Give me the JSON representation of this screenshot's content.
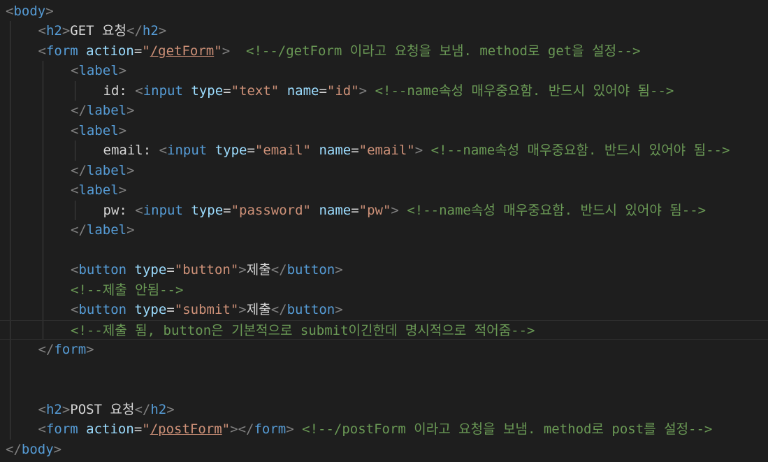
{
  "colors": {
    "background": "#1e1e1e",
    "tag": "#569cd6",
    "bracket": "#808080",
    "attribute": "#9cdcfe",
    "string": "#ce9178",
    "text": "#d4d4d4",
    "comment": "#6a9955"
  },
  "code_lines": [
    {
      "indent": 0,
      "tokens": [
        [
          "bracket",
          "<"
        ],
        [
          "tag",
          "body"
        ],
        [
          "bracket",
          ">"
        ]
      ]
    },
    {
      "indent": 1,
      "tokens": [
        [
          "bracket",
          "<"
        ],
        [
          "tag",
          "h2"
        ],
        [
          "bracket",
          ">"
        ],
        [
          "text",
          "GET 요청"
        ],
        [
          "bracket",
          "</"
        ],
        [
          "tag",
          "h2"
        ],
        [
          "bracket",
          ">"
        ]
      ]
    },
    {
      "indent": 1,
      "tokens": [
        [
          "bracket",
          "<"
        ],
        [
          "tag",
          "form"
        ],
        [
          "text",
          " "
        ],
        [
          "attr",
          "action"
        ],
        [
          "eq",
          "="
        ],
        [
          "str",
          "\""
        ],
        [
          "link",
          "/getForm"
        ],
        [
          "str",
          "\""
        ],
        [
          "bracket",
          ">"
        ],
        [
          "text",
          "  "
        ],
        [
          "comment",
          "<!--/getForm 이라고 요청을 보냄. method로 get을 설정-->"
        ]
      ]
    },
    {
      "indent": 2,
      "tokens": [
        [
          "bracket",
          "<"
        ],
        [
          "tag",
          "label"
        ],
        [
          "bracket",
          ">"
        ]
      ]
    },
    {
      "indent": 3,
      "tokens": [
        [
          "text",
          "id: "
        ],
        [
          "bracket",
          "<"
        ],
        [
          "tag",
          "input"
        ],
        [
          "text",
          " "
        ],
        [
          "attr",
          "type"
        ],
        [
          "eq",
          "="
        ],
        [
          "str",
          "\"text\""
        ],
        [
          "text",
          " "
        ],
        [
          "attr",
          "name"
        ],
        [
          "eq",
          "="
        ],
        [
          "str",
          "\"id\""
        ],
        [
          "bracket",
          ">"
        ],
        [
          "text",
          " "
        ],
        [
          "comment",
          "<!--name속성 매우중요함. 반드시 있어야 됨-->"
        ]
      ]
    },
    {
      "indent": 2,
      "tokens": [
        [
          "bracket",
          "</"
        ],
        [
          "tag",
          "label"
        ],
        [
          "bracket",
          ">"
        ]
      ]
    },
    {
      "indent": 2,
      "tokens": [
        [
          "bracket",
          "<"
        ],
        [
          "tag",
          "label"
        ],
        [
          "bracket",
          ">"
        ]
      ]
    },
    {
      "indent": 3,
      "tokens": [
        [
          "text",
          "email: "
        ],
        [
          "bracket",
          "<"
        ],
        [
          "tag",
          "input"
        ],
        [
          "text",
          " "
        ],
        [
          "attr",
          "type"
        ],
        [
          "eq",
          "="
        ],
        [
          "str",
          "\"email\""
        ],
        [
          "text",
          " "
        ],
        [
          "attr",
          "name"
        ],
        [
          "eq",
          "="
        ],
        [
          "str",
          "\"email\""
        ],
        [
          "bracket",
          ">"
        ],
        [
          "text",
          " "
        ],
        [
          "comment",
          "<!--name속성 매우중요함. 반드시 있어야 됨-->"
        ]
      ]
    },
    {
      "indent": 2,
      "tokens": [
        [
          "bracket",
          "</"
        ],
        [
          "tag",
          "label"
        ],
        [
          "bracket",
          ">"
        ]
      ]
    },
    {
      "indent": 2,
      "tokens": [
        [
          "bracket",
          "<"
        ],
        [
          "tag",
          "label"
        ],
        [
          "bracket",
          ">"
        ]
      ]
    },
    {
      "indent": 3,
      "tokens": [
        [
          "text",
          "pw: "
        ],
        [
          "bracket",
          "<"
        ],
        [
          "tag",
          "input"
        ],
        [
          "text",
          " "
        ],
        [
          "attr",
          "type"
        ],
        [
          "eq",
          "="
        ],
        [
          "str",
          "\"password\""
        ],
        [
          "text",
          " "
        ],
        [
          "attr",
          "name"
        ],
        [
          "eq",
          "="
        ],
        [
          "str",
          "\"pw\""
        ],
        [
          "bracket",
          ">"
        ],
        [
          "text",
          " "
        ],
        [
          "comment",
          "<!--name속성 매우중요함. 반드시 있어야 됨-->"
        ]
      ]
    },
    {
      "indent": 2,
      "tokens": [
        [
          "bracket",
          "</"
        ],
        [
          "tag",
          "label"
        ],
        [
          "bracket",
          ">"
        ]
      ]
    },
    {
      "indent": 0,
      "tokens": []
    },
    {
      "indent": 2,
      "tokens": [
        [
          "bracket",
          "<"
        ],
        [
          "tag",
          "button"
        ],
        [
          "text",
          " "
        ],
        [
          "attr",
          "type"
        ],
        [
          "eq",
          "="
        ],
        [
          "str",
          "\"button\""
        ],
        [
          "bracket",
          ">"
        ],
        [
          "text",
          "제출"
        ],
        [
          "bracket",
          "</"
        ],
        [
          "tag",
          "button"
        ],
        [
          "bracket",
          ">"
        ]
      ]
    },
    {
      "indent": 2,
      "tokens": [
        [
          "comment",
          "<!--제출 안됨-->"
        ]
      ]
    },
    {
      "indent": 2,
      "tokens": [
        [
          "bracket",
          "<"
        ],
        [
          "tag",
          "button"
        ],
        [
          "text",
          " "
        ],
        [
          "attr",
          "type"
        ],
        [
          "eq",
          "="
        ],
        [
          "str",
          "\"submit\""
        ],
        [
          "bracket",
          ">"
        ],
        [
          "text",
          "제출"
        ],
        [
          "bracket",
          "</"
        ],
        [
          "tag",
          "button"
        ],
        [
          "bracket",
          ">"
        ]
      ]
    },
    {
      "indent": 2,
      "current": true,
      "tokens": [
        [
          "comment",
          "<!--제출 됨, button은 기본적으로 submit이긴한데 명시적으로 적어줌-->"
        ]
      ]
    },
    {
      "indent": 1,
      "tokens": [
        [
          "bracket",
          "</"
        ],
        [
          "tag",
          "form"
        ],
        [
          "bracket",
          ">"
        ]
      ]
    },
    {
      "indent": 0,
      "tokens": []
    },
    {
      "indent": 0,
      "tokens": []
    },
    {
      "indent": 1,
      "tokens": [
        [
          "bracket",
          "<"
        ],
        [
          "tag",
          "h2"
        ],
        [
          "bracket",
          ">"
        ],
        [
          "text",
          "POST 요청"
        ],
        [
          "bracket",
          "</"
        ],
        [
          "tag",
          "h2"
        ],
        [
          "bracket",
          ">"
        ]
      ]
    },
    {
      "indent": 1,
      "tokens": [
        [
          "bracket",
          "<"
        ],
        [
          "tag",
          "form"
        ],
        [
          "text",
          " "
        ],
        [
          "attr",
          "action"
        ],
        [
          "eq",
          "="
        ],
        [
          "str",
          "\""
        ],
        [
          "link",
          "/postForm"
        ],
        [
          "str",
          "\""
        ],
        [
          "bracket",
          "></"
        ],
        [
          "tag",
          "form"
        ],
        [
          "bracket",
          ">"
        ],
        [
          "text",
          " "
        ],
        [
          "comment",
          "<!--/postForm 이라고 요청을 보냄. method로 post를 설정-->"
        ]
      ]
    },
    {
      "indent": 0,
      "tokens": [
        [
          "bracket",
          "</"
        ],
        [
          "tag",
          "body"
        ],
        [
          "bracket",
          ">"
        ]
      ]
    }
  ]
}
